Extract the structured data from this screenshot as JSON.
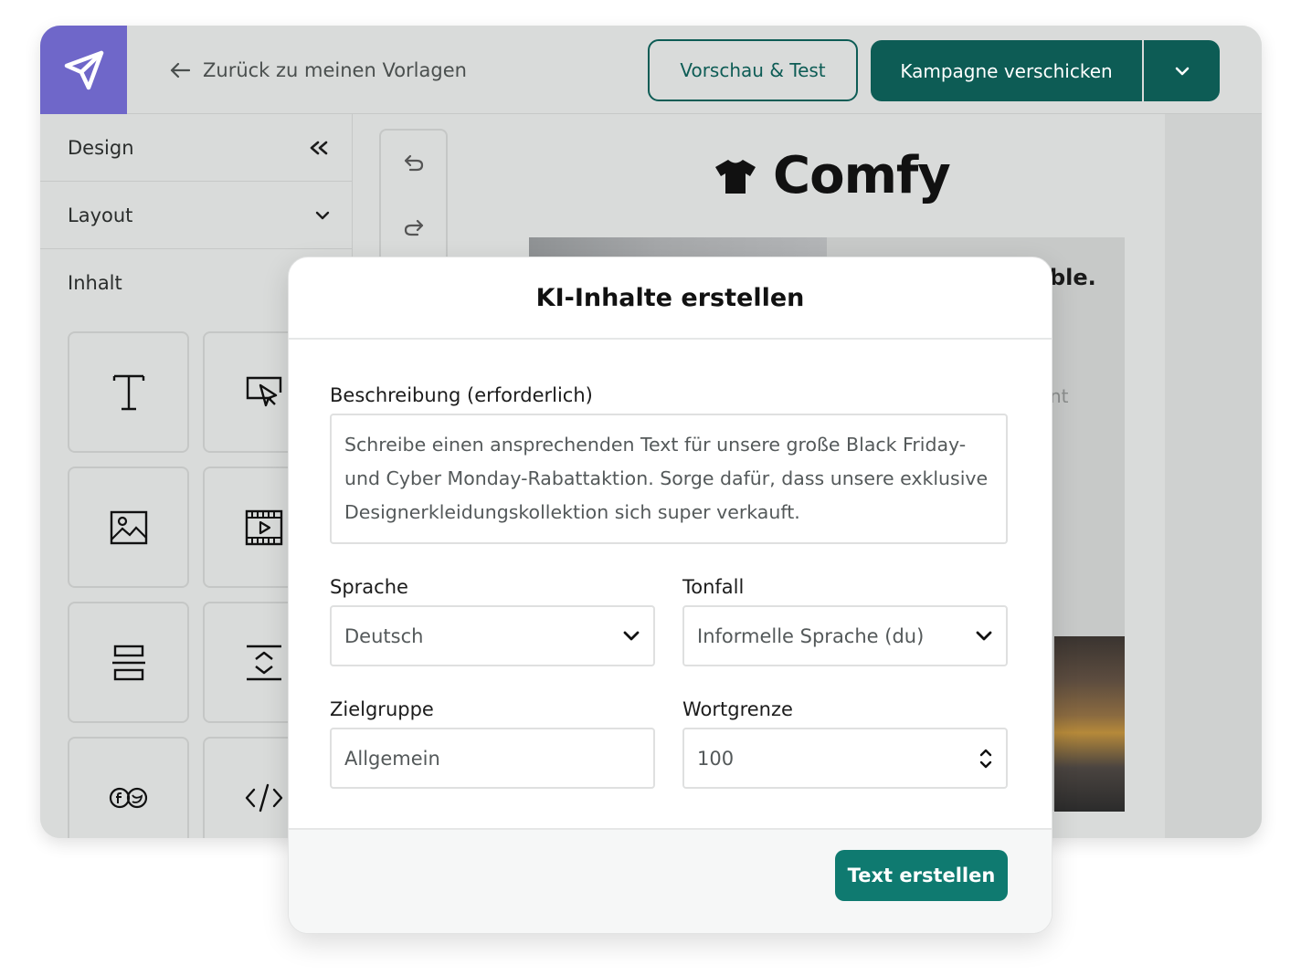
{
  "header": {
    "logo_icon": "paper-plane-icon",
    "back_label": "Zurück zu meinen Vorlagen",
    "preview_button": "Vorschau & Test",
    "send_button": "Kampagne verschicken"
  },
  "sidebar": {
    "design_label": "Design",
    "layout_label": "Layout",
    "content_label": "Inhalt",
    "tiles": [
      "text-icon",
      "button-icon",
      "image-icon",
      "video-icon",
      "divider-icon",
      "spacer-icon",
      "social-icon",
      "html-icon"
    ]
  },
  "toolbar": {
    "undo_icon": "undo-icon",
    "redo_icon": "redo-icon"
  },
  "canvas": {
    "brand": "Comfy",
    "headline_fragment": "ble.",
    "text_fragment": "nt"
  },
  "modal": {
    "title": "KI-Inhalte erstellen",
    "description_label": "Beschreibung (erforderlich)",
    "description_value": "Schreibe einen ansprechenden Text für unsere große Black Friday- und Cyber Monday-Rabattaktion. Sorge dafür, dass unsere exklusive Designerkleidungskollektion sich super verkauft.",
    "language_label": "Sprache",
    "language_value": "Deutsch",
    "tone_label": "Tonfall",
    "tone_value": "Informelle Sprache (du)",
    "audience_label": "Zielgruppe",
    "audience_value": "Allgemein",
    "word_limit_label": "Wortgrenze",
    "word_limit_value": "100",
    "submit_button": "Text erstellen"
  },
  "colors": {
    "accent": "#0d5c55",
    "logo_bg": "#6f67c9",
    "submit_bg": "#0f7a70"
  }
}
